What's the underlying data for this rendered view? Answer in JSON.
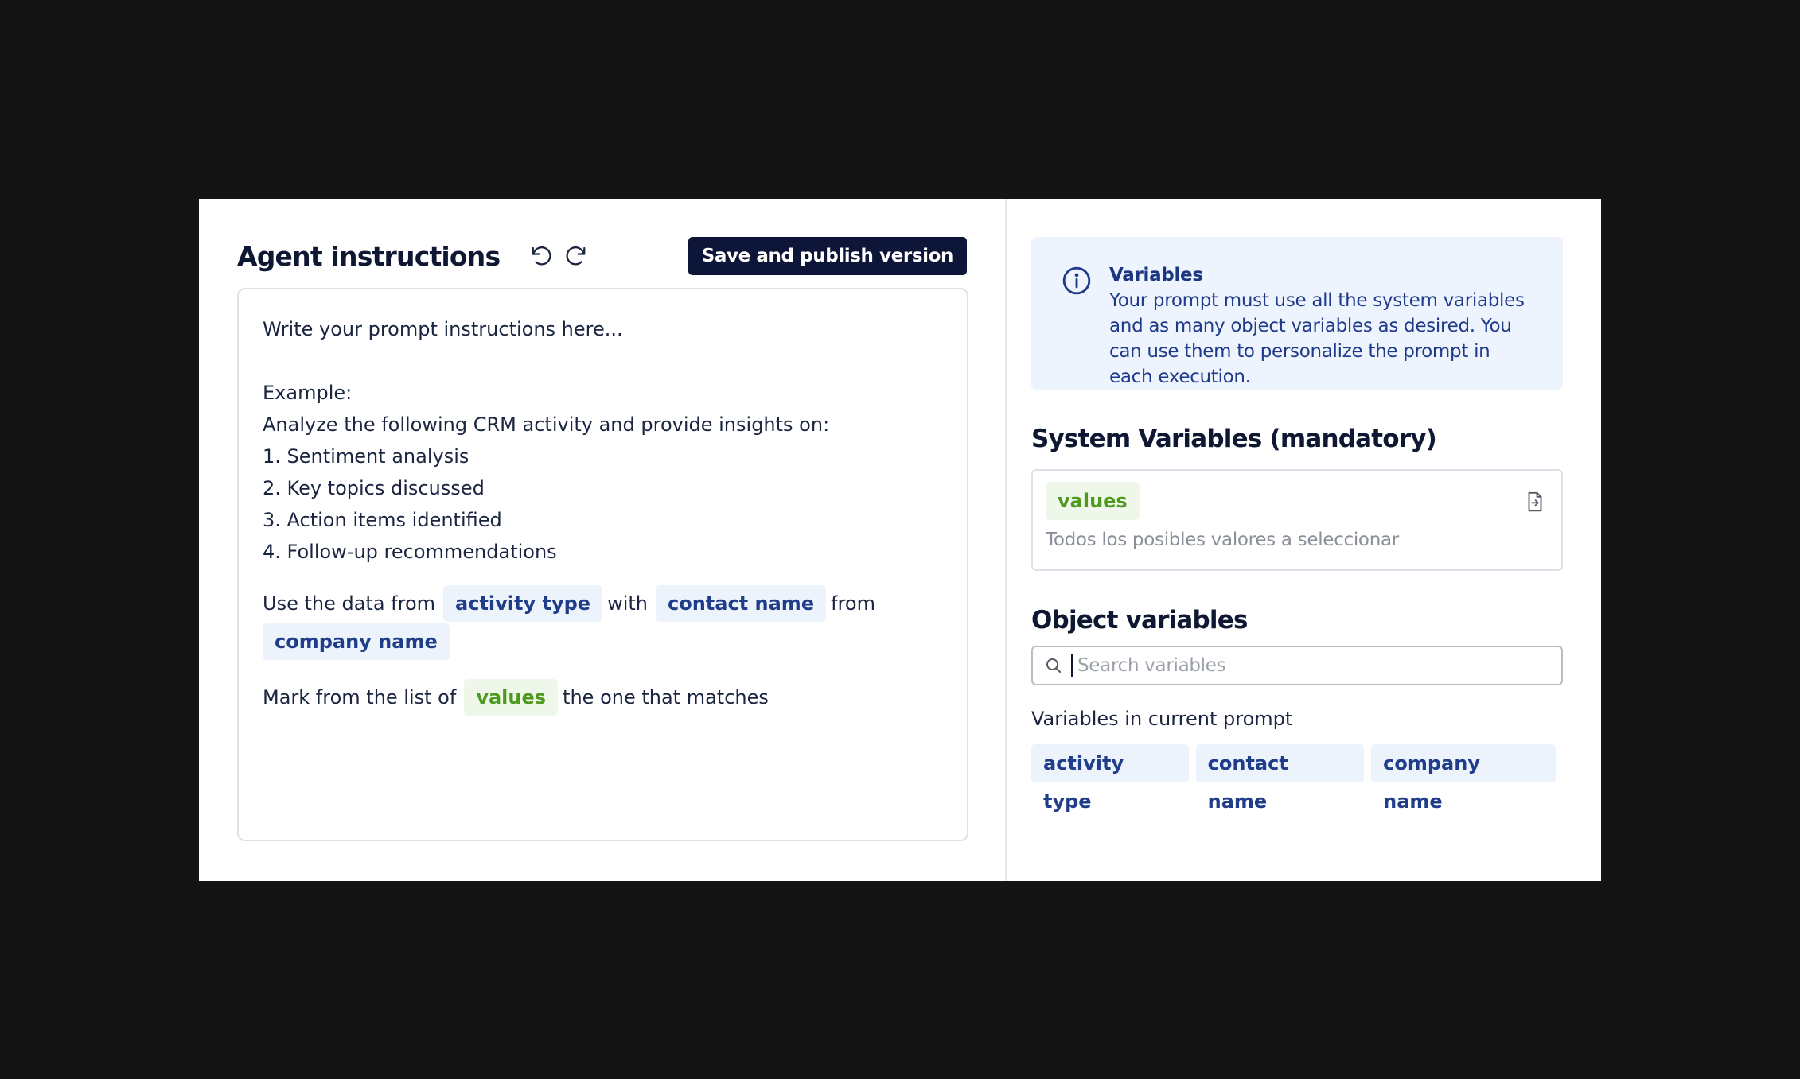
{
  "header": {
    "title": "Agent instructions",
    "publish_label": "Save and publish version"
  },
  "editor": {
    "lines": [
      "Write your prompt instructions here...",
      "Example:",
      "Analyze the following CRM activity and provide insights on:",
      "1. Sentiment analysis",
      "2. Key topics discussed",
      "3. Action items identified",
      "4. Follow-up recommendations"
    ],
    "sentence1": {
      "prefix": "Use the data from",
      "chip1": "activity type",
      "mid": "with",
      "chip2": "contact name",
      "suffix": "from",
      "chip3": "company name"
    },
    "sentence2": {
      "prefix": "Mark from the list of",
      "chip": "values",
      "suffix": "the one that matches"
    }
  },
  "info": {
    "title": "Variables",
    "body": "Your prompt must use all the system variables and as many object variables as desired. You can use them to personalize the prompt in each execution."
  },
  "system_variables": {
    "title": "System Variables (mandatory)",
    "chip": "values",
    "description": "Todos los posibles valores a seleccionar"
  },
  "object_variables": {
    "title": "Object variables",
    "search_placeholder": "Search variables",
    "current_label": "Variables in current prompt",
    "chips": [
      "activity type",
      "contact name",
      "company name"
    ]
  },
  "icons": {
    "undo": "undo-icon",
    "redo": "redo-icon",
    "info": "info-icon",
    "copy": "copy-icon",
    "search": "search-icon"
  },
  "colors": {
    "primary": "#0d1638",
    "chip_blue_bg": "#edf3fb",
    "chip_blue_text": "#1f3d8a",
    "chip_green_bg": "#eef7e9",
    "chip_green_text": "#4e9a1e",
    "info_bg": "#eef4fd"
  }
}
